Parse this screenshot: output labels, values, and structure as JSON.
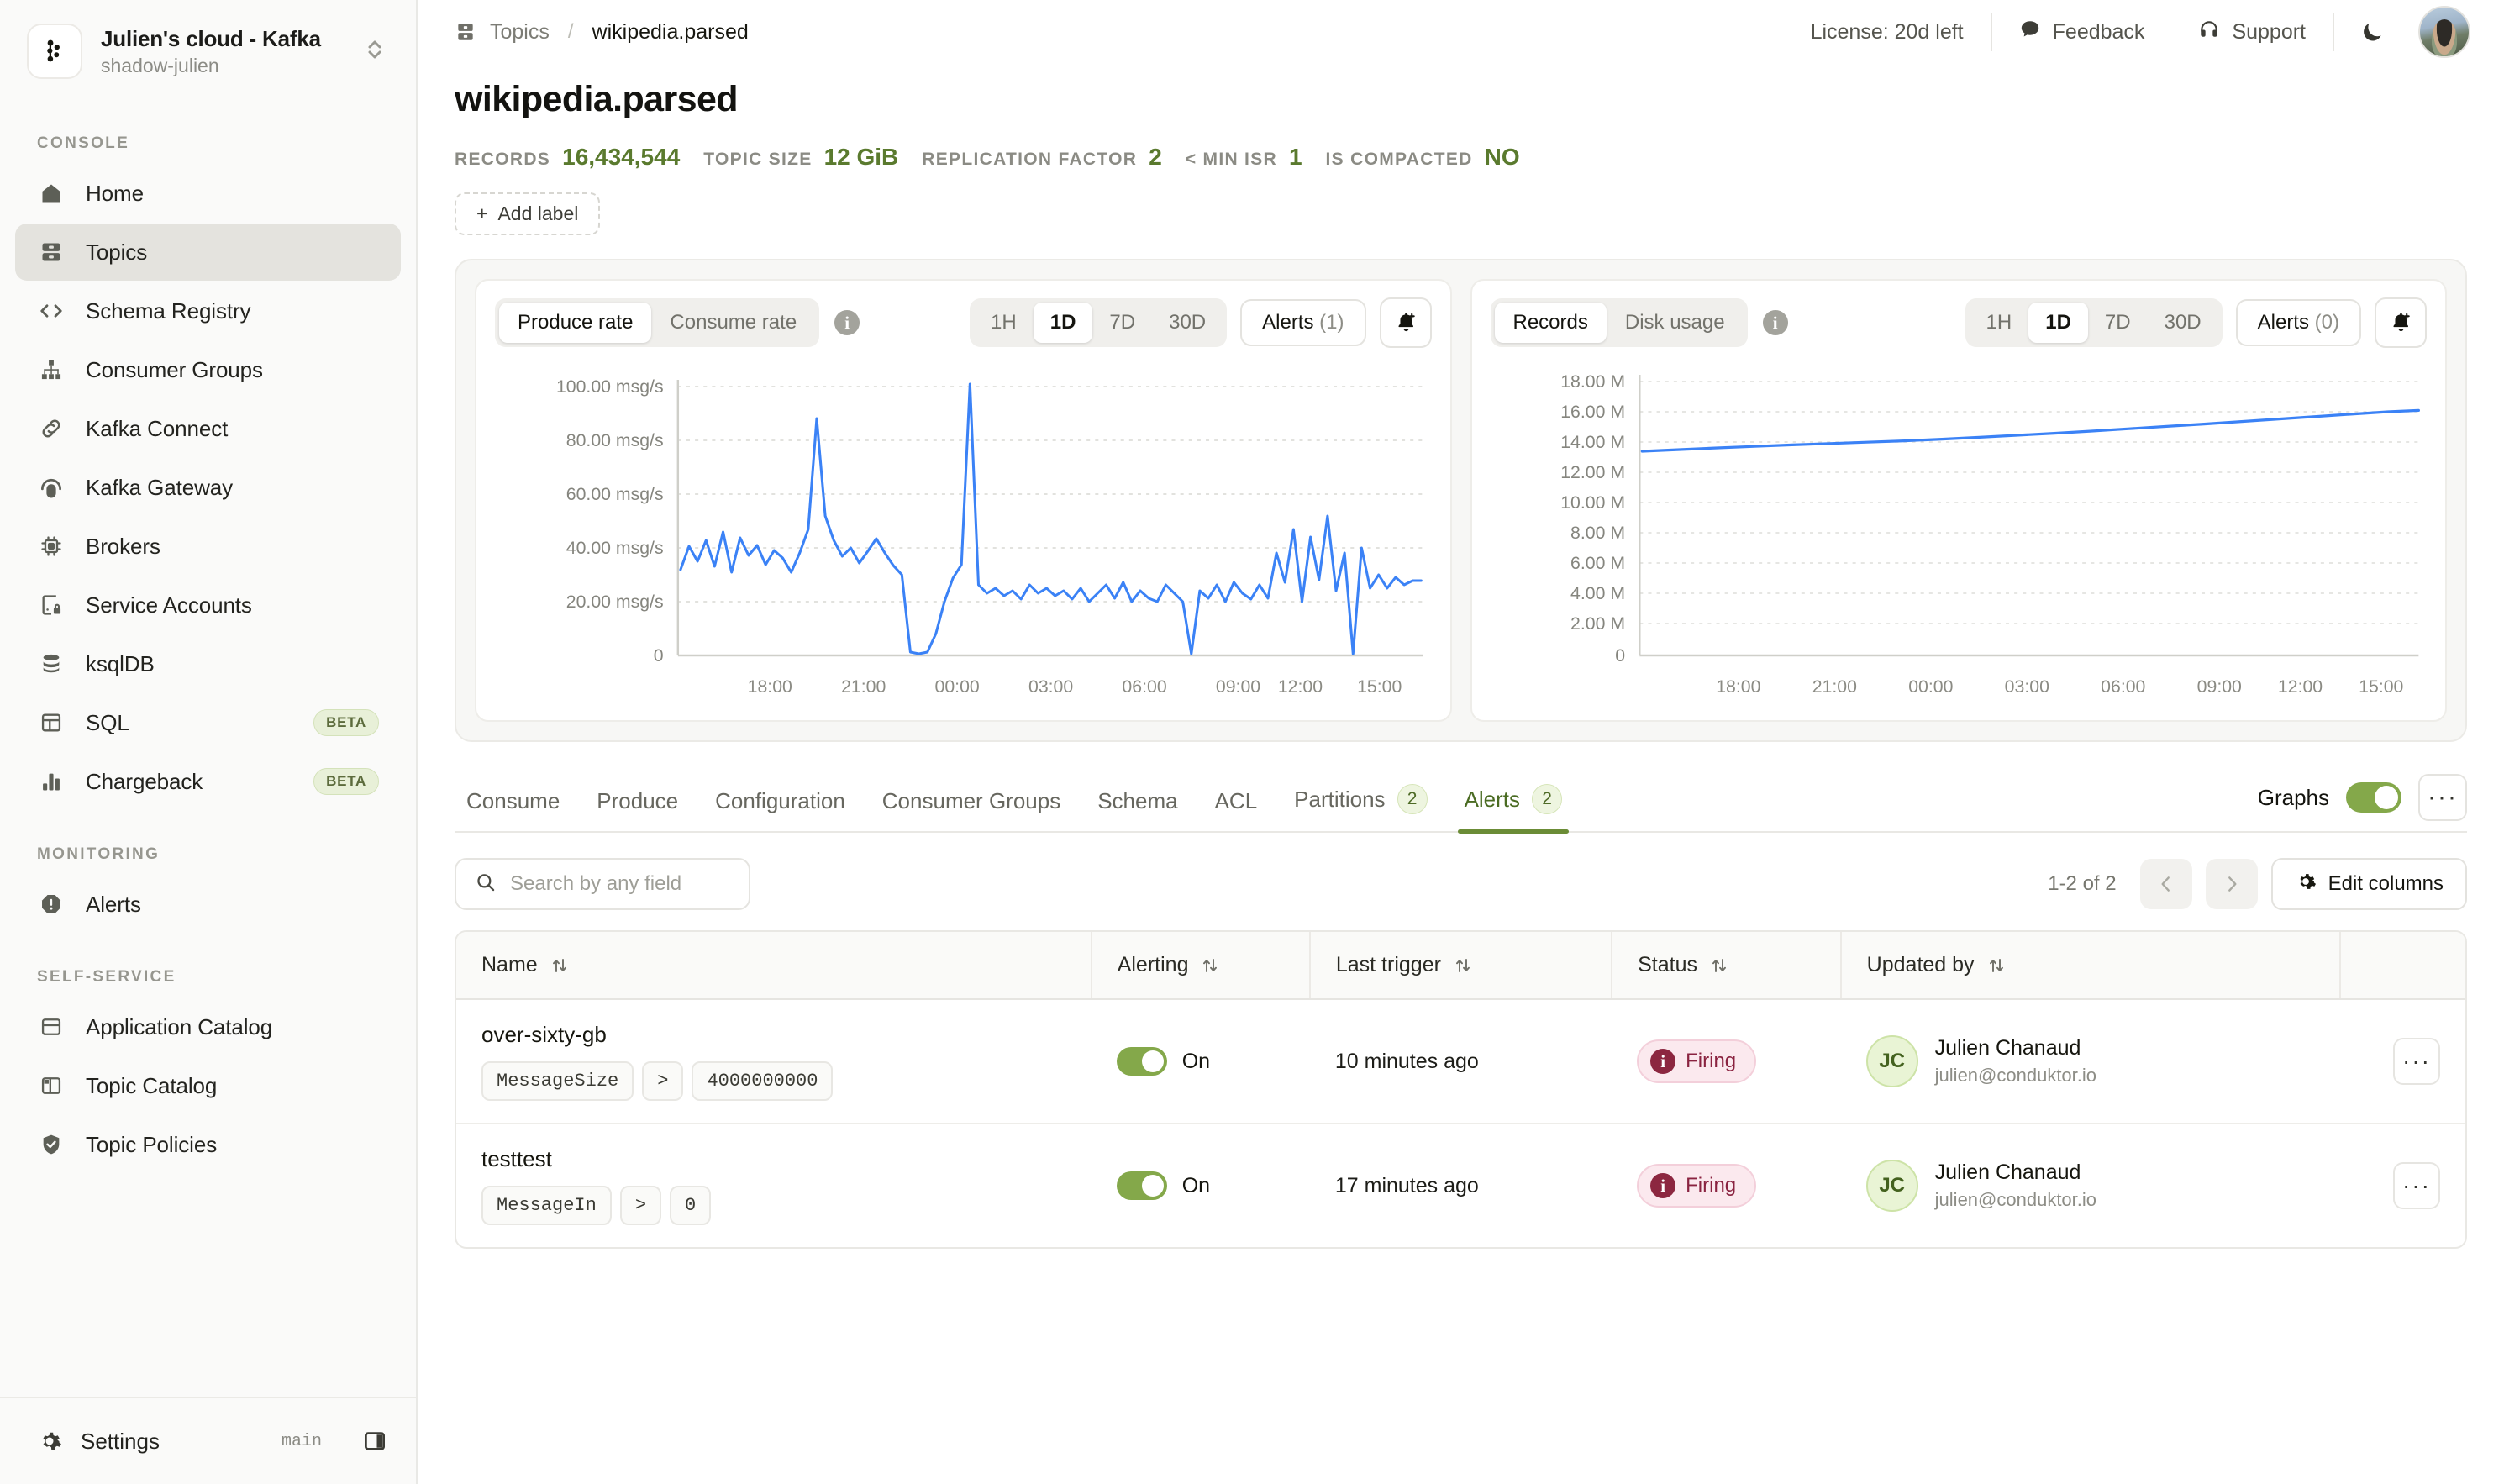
{
  "sidebar": {
    "org": {
      "title": "Julien's cloud - Kafka",
      "subtitle": "shadow-julien"
    },
    "sections": [
      {
        "label": "CONSOLE"
      },
      {
        "label": "MONITORING"
      },
      {
        "label": "SELF-SERVICE"
      }
    ],
    "console_items": [
      {
        "label": "Home",
        "icon": "home-icon"
      },
      {
        "label": "Topics",
        "icon": "topics-icon",
        "active": true
      },
      {
        "label": "Schema Registry",
        "icon": "code-brackets-icon"
      },
      {
        "label": "Consumer Groups",
        "icon": "org-tree-icon"
      },
      {
        "label": "Kafka Connect",
        "icon": "link-icon"
      },
      {
        "label": "Kafka Gateway",
        "icon": "gateway-icon"
      },
      {
        "label": "Brokers",
        "icon": "chip-icon"
      },
      {
        "label": "Service Accounts",
        "icon": "service-account-icon"
      },
      {
        "label": "ksqlDB",
        "icon": "database-icon"
      },
      {
        "label": "SQL",
        "icon": "table-icon",
        "badge": "BETA"
      },
      {
        "label": "Chargeback",
        "icon": "bar-chart-icon",
        "badge": "BETA"
      }
    ],
    "monitoring_items": [
      {
        "label": "Alerts",
        "icon": "alert-octagon-icon"
      }
    ],
    "self_service_items": [
      {
        "label": "Application Catalog",
        "icon": "window-icon"
      },
      {
        "label": "Topic Catalog",
        "icon": "layout-icon"
      },
      {
        "label": "Topic Policies",
        "icon": "shield-check-icon"
      }
    ],
    "footer": {
      "settings_label": "Settings",
      "branch": "main"
    }
  },
  "topbar": {
    "breadcrumb_root": "Topics",
    "breadcrumb_sep": "/",
    "breadcrumb_current": "wikipedia.parsed",
    "license": "License: 20d left",
    "feedback": "Feedback",
    "support": "Support"
  },
  "page": {
    "title": "wikipedia.parsed",
    "stats": [
      {
        "key": "RECORDS",
        "value": "16,434,544"
      },
      {
        "key": "TOPIC SIZE",
        "value": "12 GiB"
      },
      {
        "key": "REPLICATION FACTOR",
        "value": "2"
      },
      {
        "key": "< MIN ISR",
        "value": "1"
      },
      {
        "key": "IS COMPACTED",
        "value": "NO"
      }
    ],
    "add_label": "Add label",
    "add_label_plus": "+"
  },
  "charts": {
    "left": {
      "modes": [
        "Produce rate",
        "Consume rate"
      ],
      "active_mode": "Produce rate",
      "ranges": [
        "1H",
        "1D",
        "7D",
        "30D"
      ],
      "active_range": "1D",
      "alerts_label": "Alerts",
      "alerts_count": "(1)"
    },
    "right": {
      "modes": [
        "Records",
        "Disk usage"
      ],
      "active_mode": "Records",
      "ranges": [
        "1H",
        "1D",
        "7D",
        "30D"
      ],
      "active_range": "1D",
      "alerts_label": "Alerts",
      "alerts_count": "(0)"
    }
  },
  "chart_data": [
    {
      "type": "line",
      "title": "Produce rate",
      "xlabel": "",
      "ylabel": "msg/s",
      "ylim": [
        0,
        110
      ],
      "yticks": [
        0,
        20,
        40,
        60,
        80,
        100
      ],
      "ytick_labels": [
        "0",
        "20.00 msg/s",
        "40.00 msg/s",
        "60.00 msg/s",
        "80.00 msg/s",
        "100.00 msg/s"
      ],
      "xtick_labels": [
        "18:00",
        "21:00",
        "00:00",
        "03:00",
        "06:00",
        "09:00",
        "12:00",
        "15:00"
      ],
      "grid": true,
      "legend": "none",
      "color": "#3b82f6",
      "series": [
        {
          "name": "Produce rate",
          "values": [
            32,
            41,
            35,
            44,
            33,
            46,
            31,
            44,
            37,
            41,
            34,
            39,
            36,
            31,
            38,
            47,
            88,
            52,
            43,
            37,
            40,
            34,
            38,
            42,
            37,
            33,
            30,
            2,
            1,
            2,
            8,
            20,
            28,
            33,
            101,
            26,
            23,
            25,
            22,
            24,
            21,
            26,
            23,
            25,
            22,
            24,
            21,
            25,
            20,
            23,
            26,
            22,
            27,
            20,
            24,
            22,
            21,
            26,
            23,
            20,
            1,
            24,
            22,
            25,
            20,
            27,
            23,
            21,
            26,
            22,
            38,
            27,
            47,
            20,
            44,
            28,
            52,
            24,
            38,
            1,
            40,
            25,
            30,
            26,
            29,
            27,
            28,
            27
          ]
        }
      ]
    },
    {
      "type": "line",
      "title": "Records",
      "xlabel": "",
      "ylabel": "records",
      "ylim": [
        0,
        19000000
      ],
      "yticks": [
        0,
        2000000,
        4000000,
        6000000,
        8000000,
        10000000,
        12000000,
        14000000,
        16000000,
        18000000
      ],
      "ytick_labels": [
        "0",
        "2.00 M",
        "4.00 M",
        "6.00 M",
        "8.00 M",
        "10.00 M",
        "12.00 M",
        "14.00 M",
        "16.00 M",
        "18.00 M"
      ],
      "xtick_labels": [
        "18:00",
        "21:00",
        "00:00",
        "03:00",
        "06:00",
        "09:00",
        "12:00",
        "15:00"
      ],
      "grid": true,
      "legend": "none",
      "color": "#3b82f6",
      "series": [
        {
          "name": "Records",
          "values": [
            13500000,
            13600000,
            13700000,
            13790000,
            13880000,
            13960000,
            14040000,
            14120000,
            14220000,
            14330000,
            14450000,
            14570000,
            14700000,
            14840000,
            14980000,
            15120000,
            15270000,
            15420000,
            15570000,
            15720000,
            15850000,
            15930000
          ]
        }
      ]
    }
  ],
  "tabs": {
    "items": [
      {
        "label": "Consume"
      },
      {
        "label": "Produce"
      },
      {
        "label": "Configuration"
      },
      {
        "label": "Consumer Groups"
      },
      {
        "label": "Schema"
      },
      {
        "label": "ACL"
      },
      {
        "label": "Partitions",
        "count": "2"
      },
      {
        "label": "Alerts",
        "count": "2",
        "active": true
      }
    ],
    "graphs_label": "Graphs",
    "graphs_on": true
  },
  "table_toolbar": {
    "search_placeholder": "Search by any field",
    "search_value": "",
    "page_info": "1-2 of 2",
    "edit_columns": "Edit columns"
  },
  "table": {
    "columns": [
      "Name",
      "Alerting",
      "Last trigger",
      "Status",
      "Updated by",
      ""
    ],
    "rows": [
      {
        "name": "over-sixty-gb",
        "cond_field": "MessageSize",
        "cond_op": ">",
        "cond_value": "4000000000",
        "alerting": "On",
        "last_trigger": "10 minutes ago",
        "status": "Firing",
        "user_initials": "JC",
        "user_name": "Julien Chanaud",
        "user_email": "julien@conduktor.io"
      },
      {
        "name": "testtest",
        "cond_field": "MessageIn",
        "cond_op": ">",
        "cond_value": "0",
        "alerting": "On",
        "last_trigger": "17 minutes ago",
        "status": "Firing",
        "user_initials": "JC",
        "user_name": "Julien Chanaud",
        "user_email": "julien@conduktor.io"
      }
    ]
  },
  "colors": {
    "accent_green": "#6b8c36",
    "stat_green": "#5a7a2e",
    "chart_blue": "#3b82f6",
    "firing_red": "#8a2340"
  }
}
